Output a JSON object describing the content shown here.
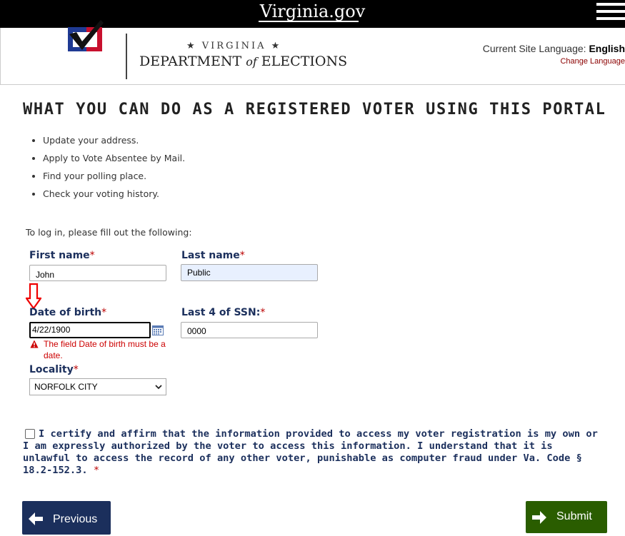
{
  "topbar": {
    "site_name": "Virginia.gov"
  },
  "header": {
    "state": "★ VIRGINIA ★",
    "department_line1": "DEPARTMENT",
    "department_of": "of",
    "department_line2": "ELECTIONS",
    "language_label": "Current Site Language:",
    "language_value": "English",
    "change_language": "Change Language"
  },
  "main": {
    "title": "WHAT YOU CAN DO AS A REGISTERED VOTER USING THIS PORTAL",
    "features": [
      "Update your address.",
      "Apply to Vote Absentee by Mail.",
      "Find your polling place.",
      "Check your voting history."
    ],
    "intro": "To log in, please fill out the following:"
  },
  "form": {
    "required_marker": "*",
    "first_name": {
      "label": "First name",
      "value": "John"
    },
    "last_name": {
      "label": "Last name",
      "value": "Public"
    },
    "dob": {
      "label": "Date of birth",
      "value": "4/22/1900",
      "error": "The field Date of birth must be a date."
    },
    "ssn": {
      "label": "Last 4 of SSN:",
      "value": "0000"
    },
    "locality": {
      "label": "Locality",
      "value": "NORFOLK CITY"
    },
    "certify": "I certify and affirm that the information provided to access my voter registration is my own or I am expressly authorized by the voter to access this information. I understand that it is unlawful to access the record of any other voter, punishable as computer fraud under Va. Code § 18.2-152.3."
  },
  "buttons": {
    "previous": "Previous",
    "submit": "Submit"
  },
  "colors": {
    "navy": "#1b2f5c",
    "green": "#2a5d00",
    "error": "#cc0000"
  }
}
